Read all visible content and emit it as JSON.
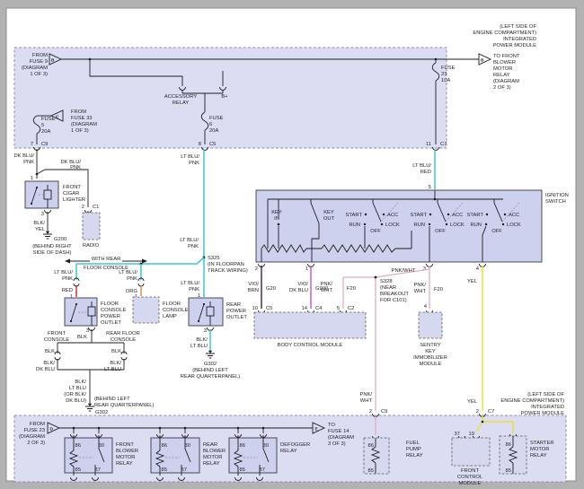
{
  "diagram": {
    "ipm_top": {
      "region": [
        "(LEFT SIDE OF",
        "ENGINE COMPARTMENT)",
        "INTEGRATED",
        "POWER MODULE"
      ],
      "from_fuse9": [
        "FROM",
        "FUSE 9",
        "(DIAGRAM",
        "1 OF 3)"
      ],
      "arrow_b_in": "B",
      "arrow_b_out": "B",
      "to_blower": [
        "TO FRONT",
        "BLOWER",
        "MOTOR",
        "RELAY",
        "(DIAGRAM",
        "2 OF 3)"
      ],
      "from_fuse33": [
        "FROM",
        "FUSE 33",
        "(DIAGRAM",
        "1 OF 3)"
      ],
      "arrow_c": "C",
      "fuse5": [
        "FUSE",
        "5",
        "20A"
      ],
      "fuse6": [
        "FUSE",
        "6",
        "20A"
      ],
      "fuse23": [
        "FUSE",
        "23",
        "10A"
      ],
      "acc_relay": [
        "ACCESSORY",
        "RELAY"
      ],
      "bplus": "B+",
      "c9": {
        "pin": "7",
        "conn": "C9"
      },
      "c5": {
        "pin": "8",
        "conn": "C5"
      },
      "c7": {
        "pin": "11",
        "conn": "C7"
      }
    },
    "cigar": {
      "wire_main": [
        "DK BLU/",
        "PNK"
      ],
      "wire_radio": [
        "DK BLU/",
        "PNK"
      ],
      "pin_in": "1",
      "name": [
        "FRONT",
        "CIGAR",
        "LIGHTER"
      ],
      "pin_gnd": "3",
      "wire_gnd": [
        "BLK/",
        "YEL"
      ],
      "gnd": "G200",
      "gnd_loc": [
        "(BEHIND RIGHT",
        "SIDE OF DASH)"
      ]
    },
    "radio": {
      "pin": "2",
      "conn": "C1",
      "name": "RADIO"
    },
    "feed": {
      "w1": [
        "LT BLU/",
        "PNK"
      ],
      "w2": [
        "LT BLU/",
        "PNK"
      ],
      "w3": [
        "LT BLU/",
        "PNK"
      ],
      "s325": [
        "S325",
        "(IN FLOORPAN",
        "TRACK WIRING)"
      ],
      "option": [
        "WITH REAR",
        "FLOOR CONSOLE"
      ]
    },
    "fcpo": {
      "wire_in": [
        "LT BLU/",
        "PNK"
      ],
      "wire_red": "RED",
      "pin_in": "1",
      "name": [
        "FLOOR",
        "CONSOLE",
        "POWER",
        "OUTLET"
      ],
      "pin_gnd": "3",
      "wire_blk": "BLK",
      "opt_front": [
        "FRONT",
        "CONSOLE"
      ],
      "opt_rear": [
        "REAR FLOOR",
        "CONSOLE"
      ],
      "blk_l": "BLK",
      "blk_r": "BLK",
      "w_dkblu": [
        "BLK/",
        "DK BLU"
      ],
      "w_ltblu": [
        "BLK/",
        "LT BLU"
      ],
      "merged": [
        "BLK/",
        "LT BLU",
        "(OR BLK/",
        "DK BLU)"
      ],
      "gnd_loc": [
        "(BEHIND LEFT",
        "REAR QUARTERPANEL)"
      ],
      "gnd": "G302"
    },
    "lamp": {
      "wire_in": [
        "LT BLU/",
        "PNK"
      ],
      "wire_org": "ORG",
      "pin": "1",
      "name": [
        "FLOOR",
        "CONSOLE",
        "LAMP"
      ]
    },
    "rpo": {
      "pin_in": "1",
      "name": [
        "REAR",
        "POWER",
        "OUTLET"
      ],
      "pin_gnd": "3",
      "wire_gnd": [
        "BLK/",
        "LT BLU"
      ],
      "gnd": "G302",
      "gnd_loc": [
        "(BEHIND LEFT",
        "REAR QUARTERPANEL)"
      ]
    },
    "ign": {
      "wire_in": [
        "LT BLU/",
        "RED"
      ],
      "pin_in": "5",
      "name": [
        "IGNITION",
        "SWITCH"
      ],
      "key_in": [
        "KEY",
        "IN"
      ],
      "key_out": [
        "KEY",
        "OUT"
      ],
      "pos": {
        "start": "START",
        "run": "RUN",
        "acc": "ACC",
        "lock": "LOCK",
        "off": "OFF"
      },
      "pins": {
        "p2": "2",
        "p1": "1",
        "p3": "3",
        "p4": "4"
      }
    },
    "bcm": {
      "name": "BODY CONTROL MODULE",
      "w1": [
        "VIO/",
        "BRN"
      ],
      "c1": "G20",
      "p1": "10",
      "cn1": "C5",
      "w2": [
        "VIO/",
        "DK BLU"
      ],
      "c2": "G900",
      "p2": "14",
      "cn2": "C4",
      "w3": [
        "PNK/",
        "WHT"
      ],
      "c3": "F20",
      "p3": "5",
      "cn3": "C2"
    },
    "s328": [
      "S328",
      "(NEAR",
      "BREAKOUT",
      "FOR C101)"
    ],
    "s328_wire": "PNK/WHT",
    "skim": {
      "w": [
        "PNK/",
        "WHT"
      ],
      "c": "F20",
      "pin": "4",
      "name": [
        "SENTRY",
        "KEY",
        "IMMOBILIZER",
        "MODULE"
      ]
    },
    "yel": {
      "w1": "YEL",
      "w2": "YEL",
      "pin": "2",
      "conn": "C7"
    },
    "pnk": {
      "w": [
        "PNK/",
        "WHT"
      ],
      "pin": "2",
      "conn": "C9"
    },
    "ipm_bot": {
      "region": [
        "(LEFT SIDE OF",
        "ENGINE COMPARTMENT)",
        "INTEGRATED",
        "POWER MODULE"
      ],
      "from_fuse23": [
        "FROM",
        "FUSE 23",
        "(DIAGRAM",
        "2 OF 3)"
      ],
      "arrow_d": "D",
      "arrow_e": "E",
      "to_fuse14": [
        "TO",
        "FUSE 14",
        "(DIAGRAM",
        "3 OF 3)"
      ],
      "relay1": [
        "FRONT",
        "BLOWER",
        "MOTOR",
        "RELAY"
      ],
      "relay2": [
        "REAR",
        "BLOWER",
        "MOTOR",
        "RELAY"
      ],
      "relay3": [
        "DEFOGGER",
        "RELAY"
      ],
      "pins": {
        "p86": "86",
        "p30": "30",
        "p85": "85",
        "p87": "87"
      },
      "fuel": [
        "FUEL",
        "PUMP",
        "RELAY"
      ],
      "fcm": {
        "name": [
          "FRONT",
          "CONTROL",
          "MODULE"
        ],
        "p37": "37",
        "p19": "19"
      },
      "starter": {
        "name": [
          "STARTER",
          "MOTOR",
          "RELAY"
        ],
        "p86": "86",
        "p85": "85"
      }
    }
  }
}
